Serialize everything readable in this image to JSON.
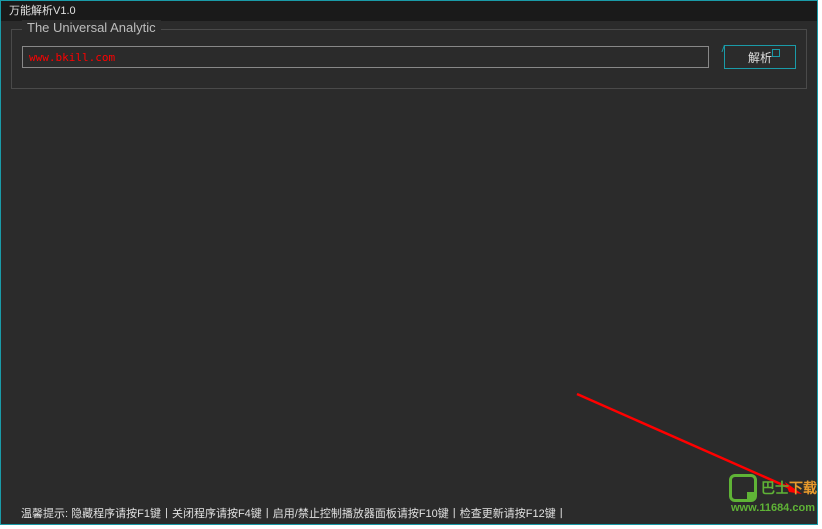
{
  "window": {
    "title": "万能解析V1.0"
  },
  "group": {
    "label": "The Universal Analytic"
  },
  "input": {
    "url_value": "www.bkill.com"
  },
  "button": {
    "parse_label": "解析"
  },
  "status": {
    "text": "温馨提示: 隐藏程序请按F1键丨关闭程序请按F4键丨启用/禁止控制播放器面板请按F10键丨检查更新请按F12键丨"
  },
  "watermark": {
    "brand_part1": "巴士",
    "brand_part2": "下载",
    "url": "www.11684.com"
  }
}
